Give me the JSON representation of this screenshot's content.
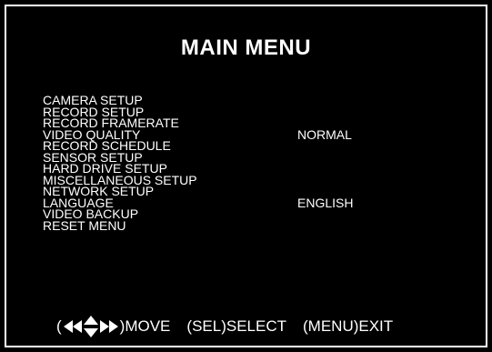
{
  "title": "MAIN MENU",
  "menu": [
    {
      "label": "CAMERA SETUP",
      "value": ""
    },
    {
      "label": "RECORD SETUP",
      "value": ""
    },
    {
      "label": "RECORD FRAMERATE",
      "value": ""
    },
    {
      "label": "VIDEO QUALITY",
      "value": "NORMAL"
    },
    {
      "label": "RECORD SCHEDULE",
      "value": ""
    },
    {
      "label": "SENSOR SETUP",
      "value": ""
    },
    {
      "label": "HARD DRIVE SETUP",
      "value": ""
    },
    {
      "label": "MISCELLANEOUS SETUP",
      "value": ""
    },
    {
      "label": "NETWORK SETUP",
      "value": ""
    },
    {
      "label": "LANGUAGE",
      "value": "ENGLISH"
    },
    {
      "label": "VIDEO BACKUP",
      "value": ""
    },
    {
      "label": "RESET MENU",
      "value": ""
    }
  ],
  "help": {
    "open_paren": "(",
    "move": ")MOVE",
    "select": "(SEL)SELECT",
    "exit": "(MENU)EXIT",
    "arrow_icons": [
      "left-left-arrows-icon",
      "up-down-arrows-icon",
      "right-right-arrows-icon"
    ]
  }
}
